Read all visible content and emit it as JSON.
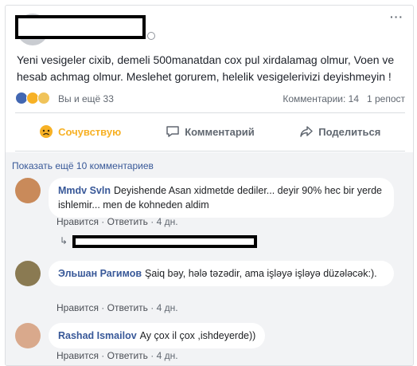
{
  "post": {
    "text": "Yeni vesigeler cixib, demeli 500manatdan cox pul xirdalamag olmur, Voen ve hesab achmag olmur. Meslehet gorurem, helelik vesigelerivizi deyishmeyin !",
    "reactions_text": "Вы и ещё 33",
    "comments_count": "Комментарии: 14",
    "shares_count": "1 репост",
    "reaction_icons": [
      "like-icon",
      "wow-icon",
      "sad-icon"
    ]
  },
  "actions": {
    "react_label": "Сочувствую",
    "comment_label": "Комментарий",
    "share_label": "Поделиться"
  },
  "comments": {
    "show_more": "Показать ещё 10 комментариев",
    "items": [
      {
        "name": "Mmdv Svln",
        "text": "Deyishende Asan xidmetde dediler... deyir 90% hec bir yerde ishlemir... men de kohneden aldim",
        "like": "Нравится",
        "reply": "Ответить",
        "time": "4 дн."
      },
      {
        "name": "Эльшан Рагимов",
        "text": "Şaiq bəy, hələ təzədir, ama işləyə işləyə düzələcək:).",
        "like": "Нравится",
        "reply": "Ответить",
        "time": "4 дн."
      },
      {
        "name": "Rashad Ismailov",
        "text": "Ay çox il çox ,ishdeyerde))",
        "like": "Нравится",
        "reply": "Ответить",
        "time": "4 дн."
      }
    ],
    "separator": "·"
  },
  "colors": {
    "link": "#385898",
    "react_active": "#f7b125",
    "muted": "#606770"
  }
}
